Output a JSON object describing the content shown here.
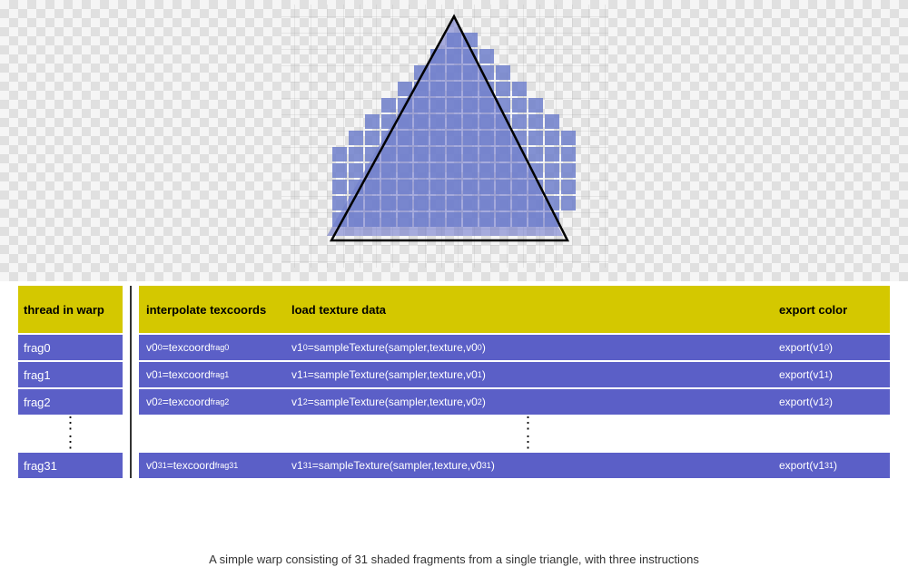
{
  "diagram": {
    "triangle_area_height": 310,
    "caption": "A simple warp consisting of 31 shaded fragments from a single triangle, with three instructions"
  },
  "table": {
    "col_thread": {
      "header": "thread in warp",
      "rows": [
        "frag0",
        "frag1",
        "frag2",
        "frag31"
      ]
    },
    "col_interpolate": {
      "header": "interpolate texcoords",
      "rows": [
        "v0₀=texcoord_frag0",
        "v0₁=texcoord_frag1",
        "v0₂=texcoord_frag2",
        "v0₃₁=texcoord_frag31"
      ]
    },
    "col_load": {
      "header": "load texture data",
      "rows": [
        "v1₀=sampleTexture(sampler,texture,v0₀)",
        "v1₁=sampleTexture(sampler,texture,v0₁)",
        "v1₂=sampleTexture(sampler,texture,v0₂)",
        "v1₃₁=sampleTexture(sampler,texture,v0₃₁)"
      ]
    },
    "col_export": {
      "header": "export color",
      "rows": [
        "export(v1₀)",
        "export(v1₁)",
        "export(v1₂)",
        "export(v1₃₁)"
      ]
    }
  }
}
